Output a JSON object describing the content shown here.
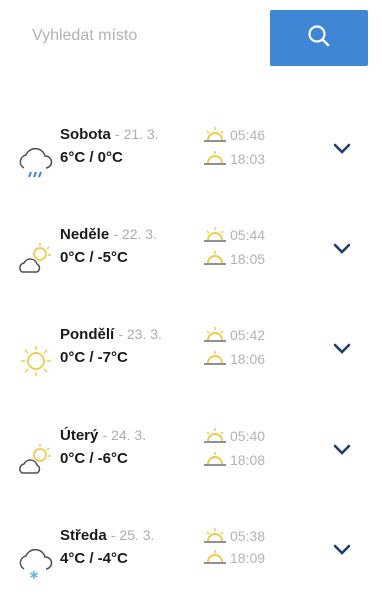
{
  "search": {
    "placeholder": "Vyhledat místo",
    "icon": "search-icon",
    "button_color": "#3f86d6"
  },
  "days": [
    {
      "name": "Sobota",
      "date": "- 21. 3.",
      "temps": "6°C / 0°C",
      "sunrise": "05:46",
      "sunset": "18:03",
      "icon": "cloud-rain-icon"
    },
    {
      "name": "Neděle",
      "date": "- 22. 3.",
      "temps": "0°C / -5°C",
      "sunrise": "05:44",
      "sunset": "18:05",
      "icon": "partly-cloudy-icon"
    },
    {
      "name": "Pondělí",
      "date": "- 23. 3.",
      "temps": "0°C / -7°C",
      "sunrise": "05:42",
      "sunset": "18:06",
      "icon": "sun-icon"
    },
    {
      "name": "Úterý",
      "date": "- 24. 3.",
      "temps": "0°C / -6°C",
      "sunrise": "05:40",
      "sunset": "18:08",
      "icon": "partly-cloudy-icon"
    },
    {
      "name": "Středa",
      "date": "- 25. 3.",
      "temps": "4°C / -4°C",
      "sunrise": "05:38",
      "sunset": "18:09",
      "icon": "cloud-snow-icon"
    }
  ],
  "colors": {
    "accent": "#3f86d6",
    "chevron": "#1e3f6e",
    "sun": "#f2c94c",
    "cloud_outline": "#4a4f58",
    "muted_text": "#a9adb3"
  }
}
